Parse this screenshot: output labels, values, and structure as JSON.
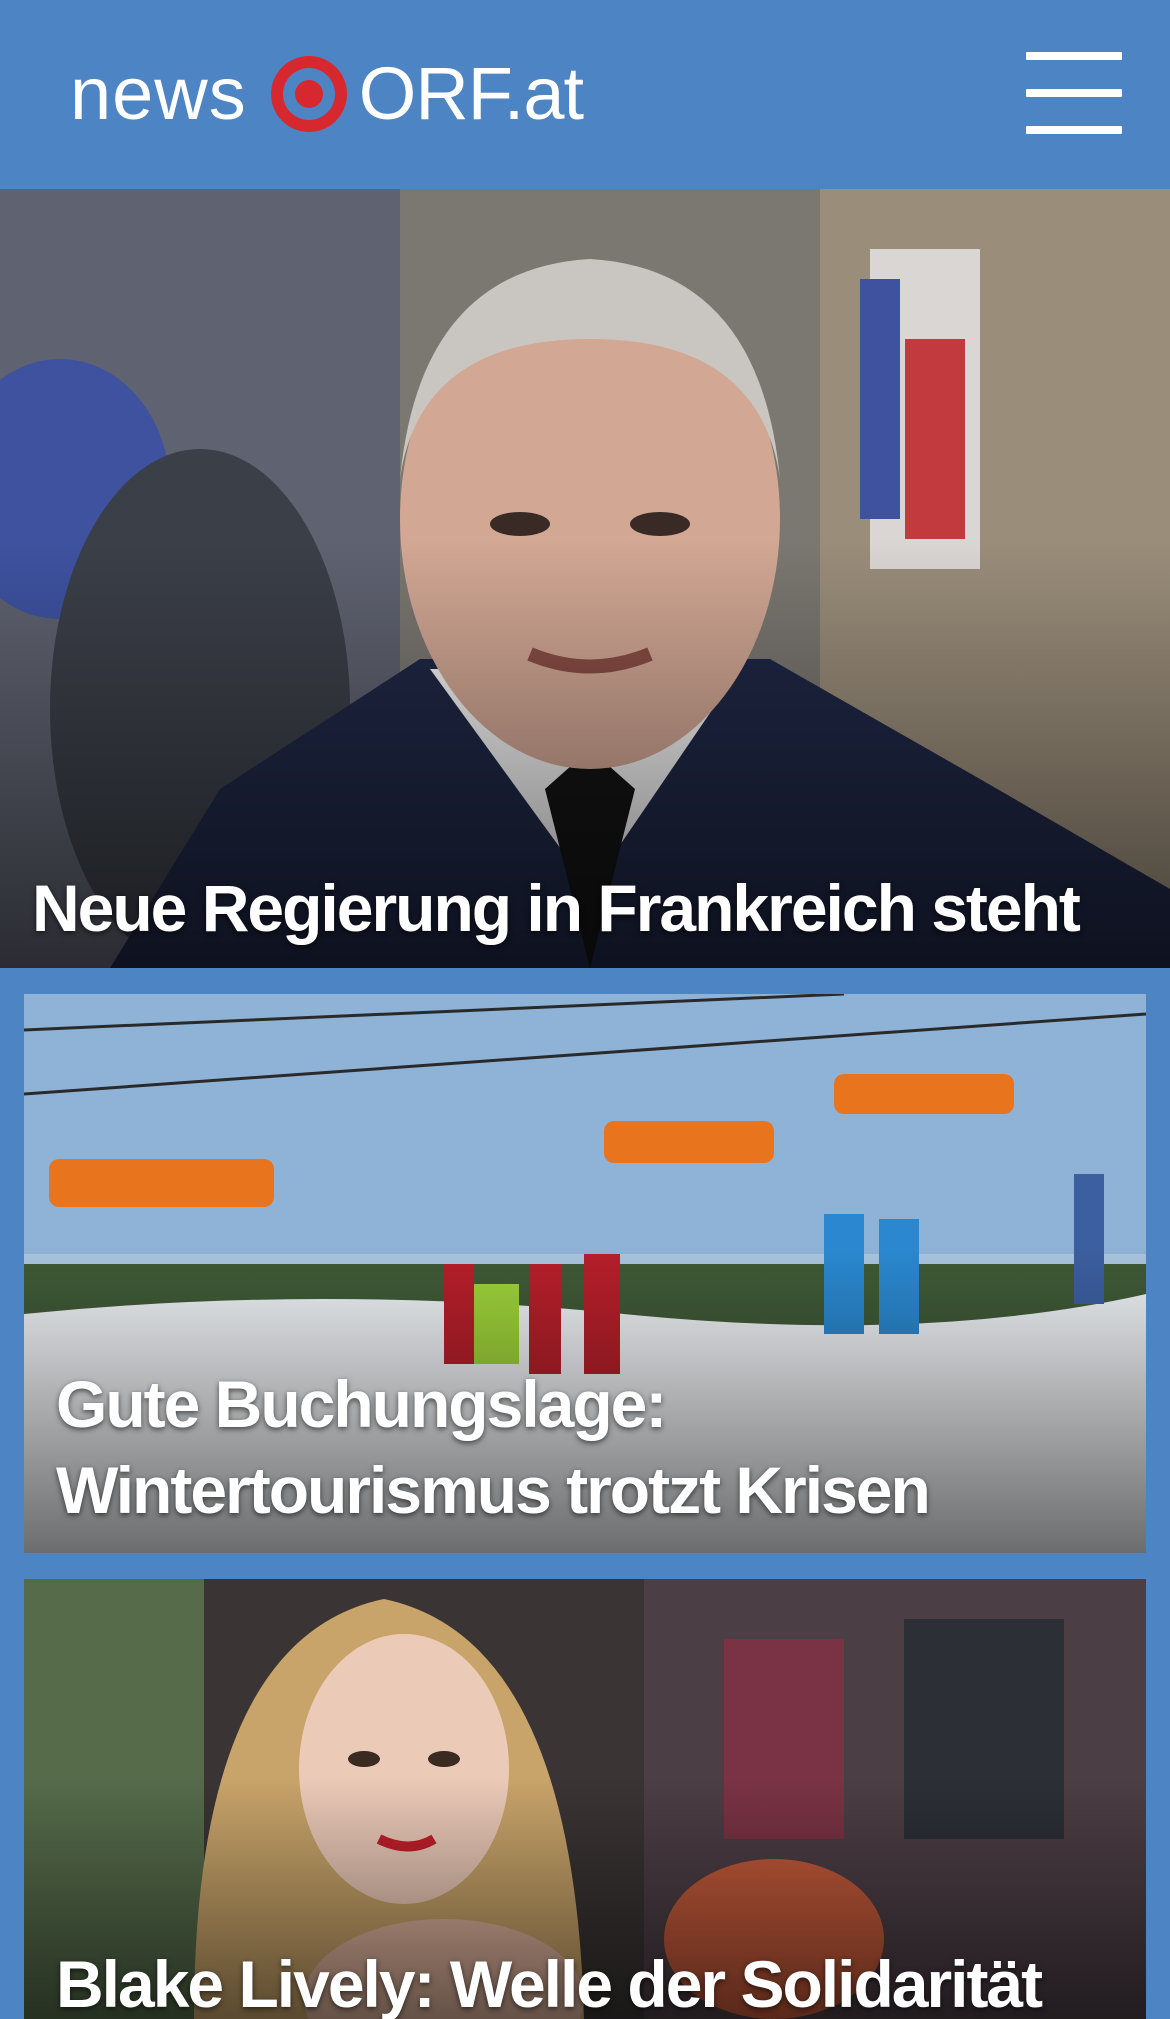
{
  "header": {
    "logo_news": "news",
    "logo_orf": "ORF.at",
    "menu_icon": "hamburger-menu-icon",
    "background": "#4d84c4",
    "logo_accent": "#d7282f"
  },
  "articles": [
    {
      "headline": "Neue Regierung in Frankreich steht",
      "image": "portrait-photo"
    },
    {
      "headline": "Gute Buchungslage: Wintertourismus trotzt Krisen",
      "image": "ski-slope-chairlift-photo"
    },
    {
      "headline": "Blake Lively: Welle der Solidarität",
      "image": "red-carpet-portrait-photo"
    }
  ]
}
